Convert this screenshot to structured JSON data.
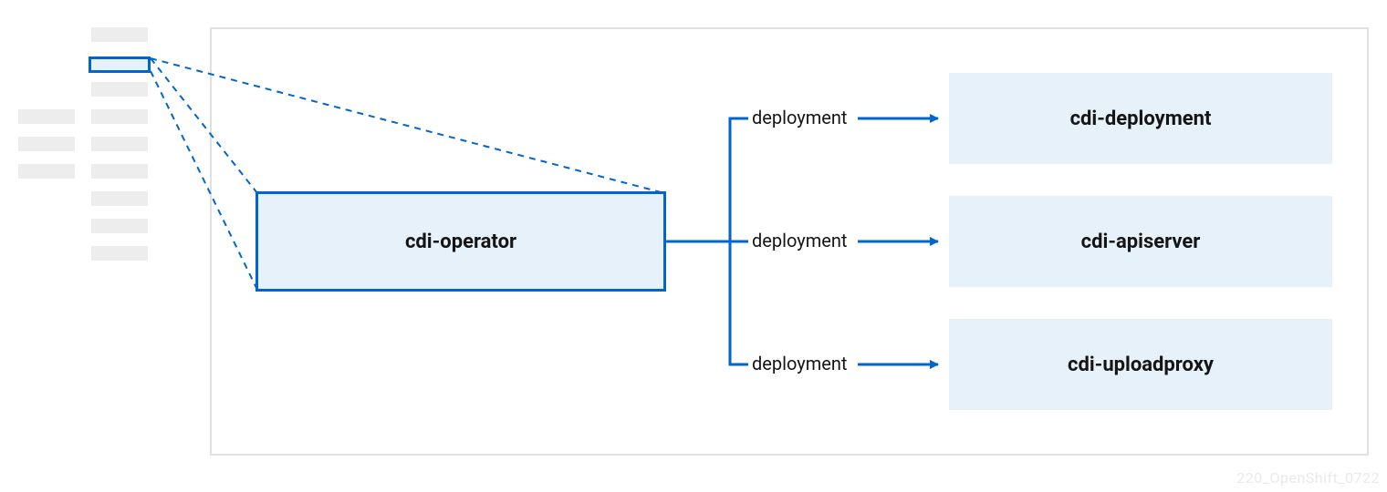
{
  "colors": {
    "accent": "#0066cc",
    "fill_light": "#e7f1fa",
    "gray_block": "#ededed",
    "frame_border": "#e0e0e0",
    "text": "#151515",
    "footer": "#e9e9e9"
  },
  "operator": {
    "label": "cdi-operator"
  },
  "edges": {
    "label": "deployment"
  },
  "deployments": [
    {
      "label": "cdi-deployment"
    },
    {
      "label": "cdi-apiserver"
    },
    {
      "label": "cdi-uploadproxy"
    }
  ],
  "footer": {
    "note": "220_OpenShift_0722"
  }
}
